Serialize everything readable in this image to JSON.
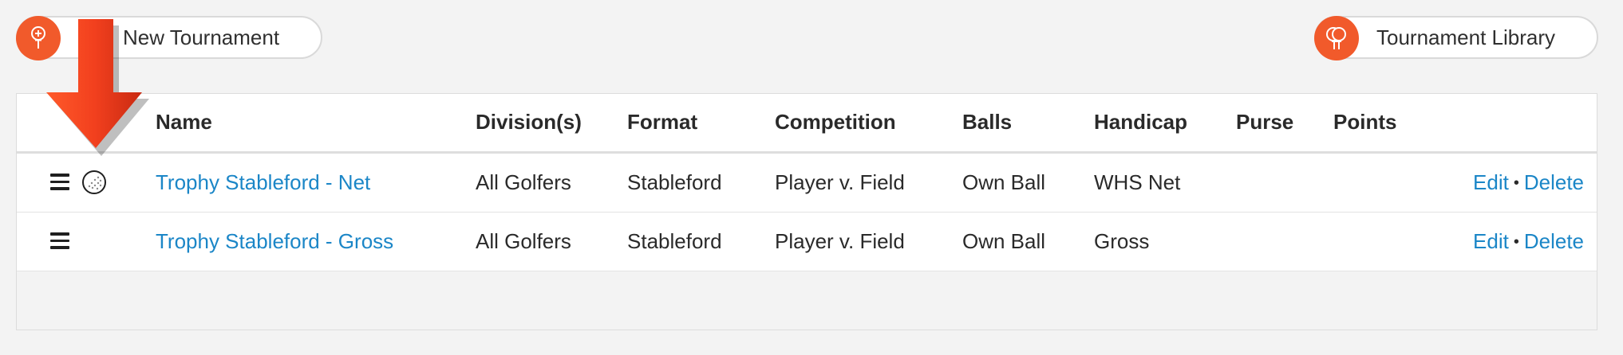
{
  "toolbar": {
    "new_tournament_label": "New Tournament",
    "tournament_library_label": "Tournament Library"
  },
  "table": {
    "headers": {
      "name": "Name",
      "divisions": "Division(s)",
      "format": "Format",
      "competition": "Competition",
      "balls": "Balls",
      "handicap": "Handicap",
      "purse": "Purse",
      "points": "Points"
    },
    "rows": [
      {
        "name": "Trophy Stableford - Net",
        "divisions": "All Golfers",
        "format": "Stableford",
        "competition": "Player v. Field",
        "balls": "Own Ball",
        "handicap": "WHS Net",
        "purse": "",
        "points": "",
        "edit": "Edit",
        "delete": "Delete",
        "separator": "•"
      },
      {
        "name": "Trophy Stableford - Gross",
        "divisions": "All Golfers",
        "format": "Stableford",
        "competition": "Player v. Field",
        "balls": "Own Ball",
        "handicap": "Gross",
        "purse": "",
        "points": "",
        "edit": "Edit",
        "delete": "Delete",
        "separator": "•"
      }
    ]
  },
  "colors": {
    "accent": "#f15a2b",
    "link": "#1b86c7",
    "annotation_arrow": "#e8341c"
  },
  "icons": {
    "new_tournament": "golf-tee-plus-icon",
    "tournament_library": "golf-balls-stack-icon",
    "drag_handle": "hamburger-icon",
    "row_ball": "golf-ball-icon"
  }
}
